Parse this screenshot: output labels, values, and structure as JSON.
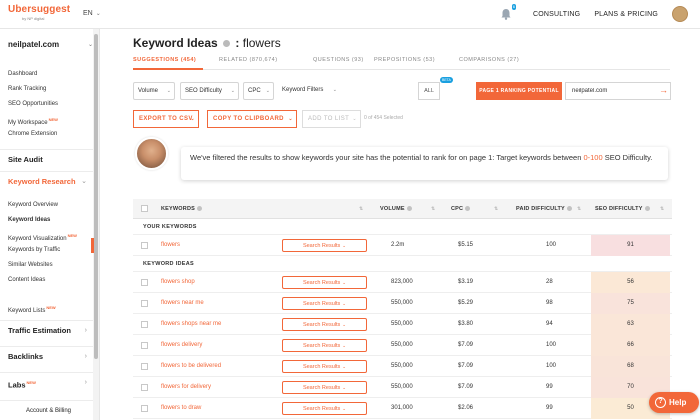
{
  "topbar": {
    "logo": "Ubersuggest",
    "logo_by": "by NP digital",
    "language": "EN",
    "notification_count": "6",
    "consulting": "CONSULTING",
    "plans": "PLANS & PRICING"
  },
  "sidebar": {
    "site": "neilpatel.com",
    "items": [
      {
        "label": "Dashboard",
        "new": ""
      },
      {
        "label": "Rank Tracking",
        "new": ""
      },
      {
        "label": "SEO Opportunities",
        "new": ""
      },
      {
        "label": "My Workspace",
        "new": "NEW"
      },
      {
        "label": "Chrome Extension",
        "new": ""
      }
    ],
    "site_audit": "Site Audit",
    "keyword_research": "Keyword Research",
    "kr_items": [
      {
        "label": "Keyword Overview",
        "new": ""
      },
      {
        "label": "Keyword Ideas",
        "new": ""
      },
      {
        "label": "Keyword Visualization",
        "new": "NEW"
      },
      {
        "label": "Keywords by Traffic",
        "new": ""
      },
      {
        "label": "Similar Websites",
        "new": ""
      },
      {
        "label": "Content Ideas",
        "new": ""
      }
    ],
    "keyword_lists": "Keyword Lists",
    "keyword_lists_new": "NEW",
    "traffic_estimation": "Traffic Estimation",
    "backlinks": "Backlinks",
    "labs": "Labs",
    "labs_new": "NEW",
    "account": "Account & Billing"
  },
  "main": {
    "title": "Keyword Ideas",
    "title_sep": ":",
    "keyword": "flowers",
    "tabs": [
      "SUGGESTIONS (454)",
      "RELATED (870,674)",
      "QUESTIONS (93)",
      "PREPOSITIONS (53)",
      "COMPARISONS (27)"
    ],
    "filters": {
      "volume": "Volume",
      "seo_difficulty": "SEO Difficulty",
      "cpc": "CPC",
      "keyword_filters": "Keyword Filters",
      "all": "ALL",
      "beta": "BETA",
      "page1": "PAGE 1 RANKING POTENTIAL",
      "domain": "neilpatel.com"
    },
    "actions": {
      "export": "EXPORT TO CSV",
      "copy": "COPY TO CLIPBOARD",
      "add_list": "ADD TO LIST",
      "selected": "0 of 454 Selected"
    },
    "notice": {
      "text_before": "We've filtered the results to show keywords your site has the potential to rank for on page 1: Target keywords between ",
      "range": "0-100",
      "text_after": " SEO Difficulty."
    },
    "table": {
      "headers": {
        "keywords": "KEYWORDS",
        "volume": "VOLUME",
        "cpc": "CPC",
        "paid": "PAID DIFFICULTY",
        "seo": "SEO DIFFICULTY"
      },
      "group_your": "YOUR KEYWORDS",
      "group_ideas": "KEYWORD IDEAS",
      "search_results": "Search Results",
      "your_rows": [
        {
          "keyword": "flowers",
          "volume": "2.2m",
          "cpc": "$5.15",
          "paid": "100",
          "seo": "91",
          "color": "#f8dfe0"
        }
      ],
      "idea_rows": [
        {
          "keyword": "flowers shop",
          "volume": "823,000",
          "cpc": "$3.19",
          "paid": "28",
          "seo": "56",
          "color": "#fbe8d6"
        },
        {
          "keyword": "flowers near me",
          "volume": "550,000",
          "cpc": "$5.29",
          "paid": "98",
          "seo": "75",
          "color": "#f9e3db"
        },
        {
          "keyword": "flowers shops near me",
          "volume": "550,000",
          "cpc": "$3.80",
          "paid": "94",
          "seo": "63",
          "color": "#fae6d8"
        },
        {
          "keyword": "flowers delivery",
          "volume": "550,000",
          "cpc": "$7.09",
          "paid": "100",
          "seo": "66",
          "color": "#fae6d8"
        },
        {
          "keyword": "flowers to be delivered",
          "volume": "550,000",
          "cpc": "$7.09",
          "paid": "100",
          "seo": "68",
          "color": "#f9e4d9"
        },
        {
          "keyword": "flowers for delivery",
          "volume": "550,000",
          "cpc": "$7.09",
          "paid": "99",
          "seo": "70",
          "color": "#f9e3da"
        },
        {
          "keyword": "flowers to draw",
          "volume": "301,000",
          "cpc": "$2.06",
          "paid": "99",
          "seo": "50",
          "color": "#fbebd5"
        }
      ]
    }
  },
  "help": "Help"
}
